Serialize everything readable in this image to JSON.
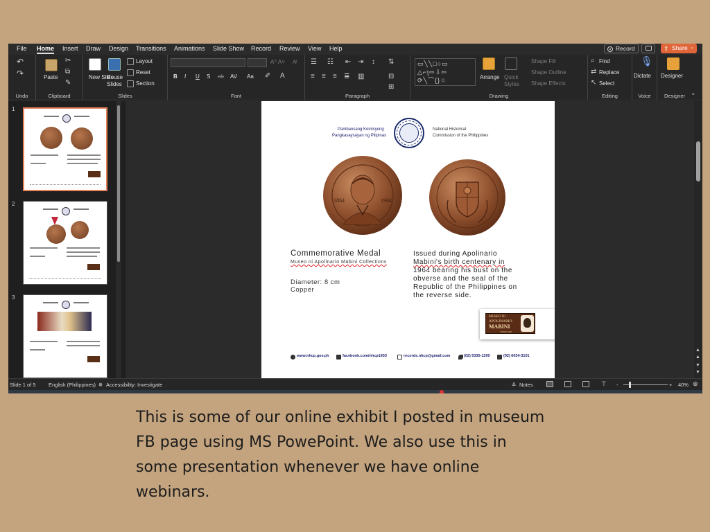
{
  "menu": {
    "items": [
      "File",
      "Home",
      "Insert",
      "Draw",
      "Design",
      "Transitions",
      "Animations",
      "Slide Show",
      "Record",
      "Review",
      "View",
      "Help"
    ],
    "active": "Home",
    "record_label": "Record",
    "share_label": "Share"
  },
  "ribbon": {
    "undo_label": "Undo",
    "clipboard": {
      "paste_label": "Paste",
      "group_label": "Clipboard"
    },
    "slides": {
      "new_slide_label": "New Slide",
      "new_slide_sub": "Slide",
      "reuse_label": "Reuse",
      "reuse_sub": "Slides",
      "layout_label": "Layout",
      "reset_label": "Reset",
      "section_label": "Section",
      "group_label": "Slides"
    },
    "font": {
      "group_label": "Font",
      "bold": "B",
      "italic": "I",
      "underline": "U",
      "strike": "S",
      "spacing": "AV",
      "case": "Aa"
    },
    "paragraph": {
      "group_label": "Paragraph"
    },
    "drawing": {
      "arrange_label": "Arrange",
      "quick_styles_label": "Quick",
      "quick_styles_sub": "Styles",
      "shape_fill": "Shape Fill",
      "shape_outline": "Shape Outline",
      "shape_effects": "Shape Effects",
      "group_label": "Drawing"
    },
    "editing": {
      "find": "Find",
      "replace": "Replace",
      "select": "Select",
      "group_label": "Editing"
    },
    "voice": {
      "dictate": "Dictate",
      "group_label": "Voice"
    },
    "designer": {
      "designer": "Designer",
      "group_label": "Designer"
    }
  },
  "thumbnails": [
    {
      "number": "1",
      "selected": true
    },
    {
      "number": "2",
      "selected": false
    },
    {
      "number": "3",
      "selected": false
    }
  ],
  "slide": {
    "agency_fil_1": "Pambansang Komisyong",
    "agency_fil_2": "Pangkasaysayan ng Pilipinas",
    "agency_en_1": "National Historical",
    "agency_en_2": "Commission of the Philippines",
    "medal_years_left": "1864",
    "medal_years_right": "1964",
    "object_title": "Commemorative Medal",
    "collection": "Museo ni Apolinario Mabini Collections",
    "diameter": "Diameter: 8 cm",
    "material": "Copper",
    "description_lines": [
      "Issued during Apolinario",
      "Mabini's birth centenary in",
      "1964 bearing his bust on the",
      "obverse and the seal of the",
      "Republic of the Philippines on",
      "the reverse side."
    ],
    "museum_logo": {
      "line1": "MUSEO NI",
      "line2": "APOLINARIO",
      "line3": "MABINI",
      "line4": "TANAUAN"
    },
    "contacts": {
      "website": "www.nhcp.gov.ph",
      "facebook": "facebook.com/nhcp1933",
      "email": "records.nhcp@gmail.com",
      "phone": "(02) 5335-1200",
      "fax": "(02) 6034-3101"
    }
  },
  "status": {
    "slide_counter": "Slide 1 of 5",
    "language": "English (Philippines)",
    "accessibility": "Accessibility: Investigate",
    "notes_label": "Notes",
    "zoom_minus": "-",
    "zoom_plus": "+",
    "zoom": "40%"
  },
  "caption_lines": [
    "This is some of our online exhibit I posted in museum",
    "FB page using MS PowePoint. We also use this in",
    "some presentation whenever we have online",
    "webinars."
  ],
  "colors": {
    "background": "#c4a47f",
    "share_accent": "#e0663a",
    "selected_thumb": "#e8835a",
    "medal_copper": "#9a5a35"
  }
}
